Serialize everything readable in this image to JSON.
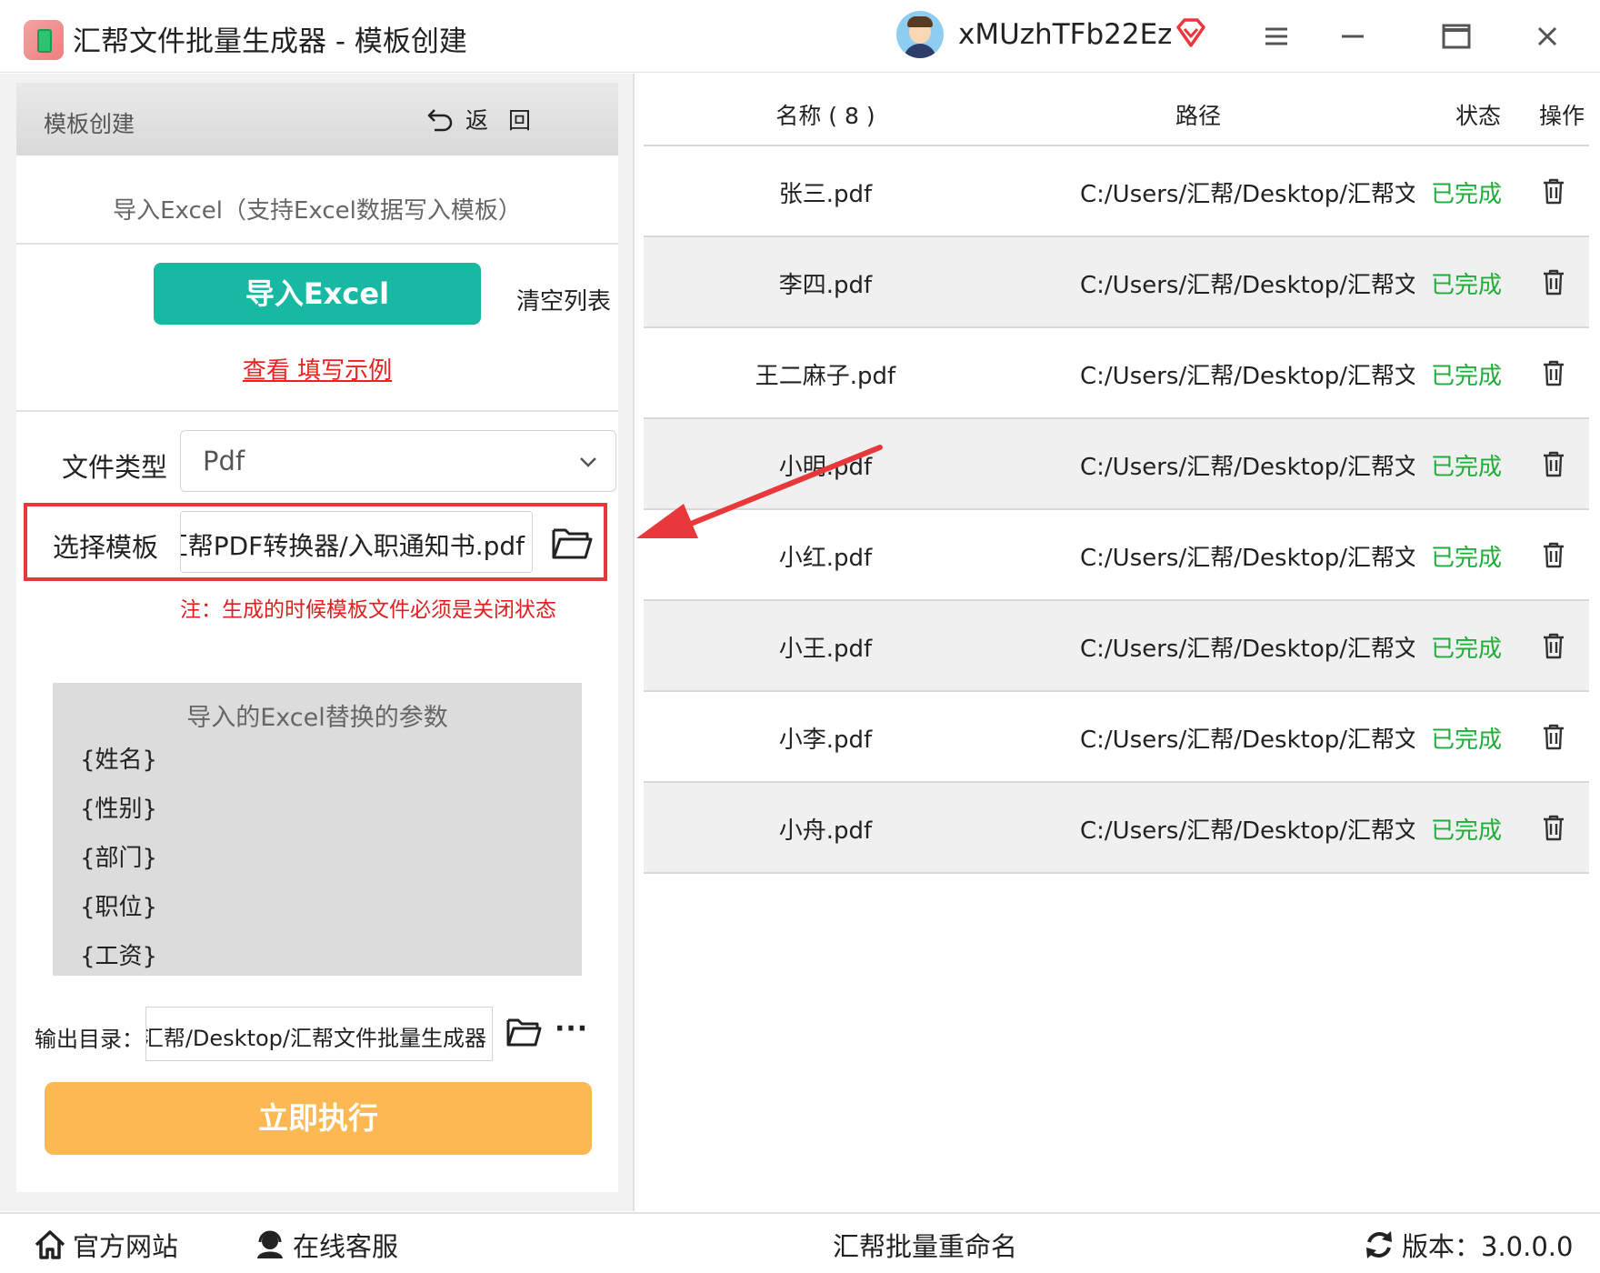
{
  "window": {
    "title": "汇帮文件批量生成器 - 模板创建",
    "username": "xMUzhTFb22Ez",
    "icons": {
      "menu": "menu-icon",
      "minimize": "minimize-icon",
      "maximize": "maximize-icon",
      "close": "close-icon",
      "vip": "vip-diamond-icon"
    }
  },
  "left_panel": {
    "header_title": "模板创建",
    "back_label": "返回",
    "import_note": "导入Excel（支持Excel数据写入模板）",
    "import_button": "导入Excel",
    "clear_list": "清空列表",
    "example_link": "查看 填写示例",
    "file_type_label": "文件类型",
    "file_type_value": "Pdf",
    "template_label": "选择模板",
    "template_value": "汇帮PDF转换器/入职通知书.pdf",
    "note": "注：生成的时候模板文件必须是关闭状态",
    "params_title": "导入的Excel替换的参数",
    "params": [
      "{姓名}",
      "{性别}",
      "{部门}",
      "{职位}",
      "{工资}"
    ],
    "output_label": "输出目录：",
    "output_value": "汇帮/Desktop/汇帮文件批量生成器",
    "more_label": "···",
    "run_button": "立即执行"
  },
  "table": {
    "headers": {
      "name": "名称 ( 8 )",
      "path": "路径",
      "status": "状态",
      "action": "操作"
    },
    "rows": [
      {
        "name": "张三.pdf",
        "path": "C:/Users/汇帮/Desktop/汇帮文件",
        "status": "已完成"
      },
      {
        "name": "李四.pdf",
        "path": "C:/Users/汇帮/Desktop/汇帮文件",
        "status": "已完成"
      },
      {
        "name": "王二麻子.pdf",
        "path": "C:/Users/汇帮/Desktop/汇帮文件",
        "status": "已完成"
      },
      {
        "name": "小明.pdf",
        "path": "C:/Users/汇帮/Desktop/汇帮文件",
        "status": "已完成"
      },
      {
        "name": "小红.pdf",
        "path": "C:/Users/汇帮/Desktop/汇帮文件",
        "status": "已完成"
      },
      {
        "name": "小王.pdf",
        "path": "C:/Users/汇帮/Desktop/汇帮文件",
        "status": "已完成"
      },
      {
        "name": "小李.pdf",
        "path": "C:/Users/汇帮/Desktop/汇帮文件",
        "status": "已完成"
      },
      {
        "name": "小舟.pdf",
        "path": "C:/Users/汇帮/Desktop/汇帮文件",
        "status": "已完成"
      }
    ]
  },
  "footer": {
    "website": "官方网站",
    "service": "在线客服",
    "rename": "汇帮批量重命名",
    "version": "版本：3.0.0.0"
  },
  "colors": {
    "accent_teal": "#17b9a2",
    "run_orange": "#fcb853",
    "status_green": "#1fae3a",
    "highlight_red": "#e8383c"
  }
}
